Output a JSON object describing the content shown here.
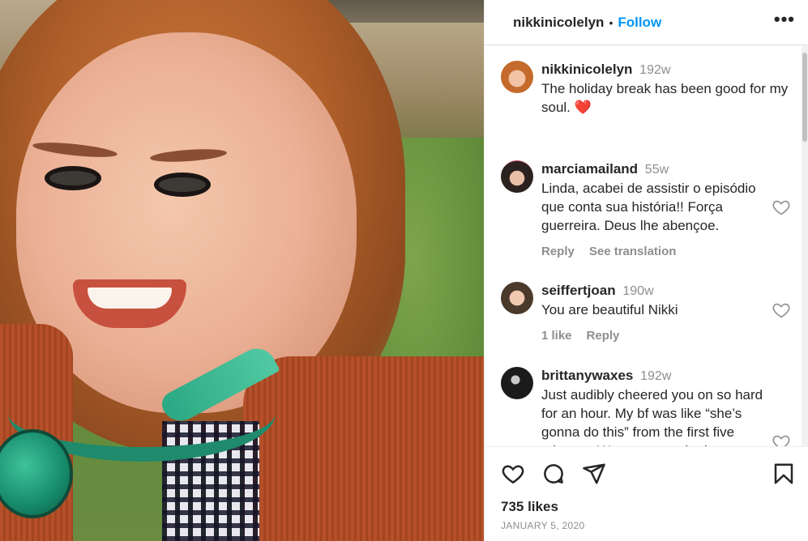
{
  "post": {
    "username": "nikkinicolelyn",
    "separator": "•",
    "follow_label": "Follow",
    "more_icon": "more-horizontal-icon"
  },
  "caption": {
    "username": "nikkinicolelyn",
    "time": "192w",
    "text": "The holiday break has been good for my soul. ❤️"
  },
  "comments": [
    {
      "username": "marciamailand",
      "time": "55w",
      "text": "Linda, acabei de assistir o episódio que conta sua história!! Força guerreira. Deus lhe abençoe.",
      "actions": [
        "Reply",
        "See translation"
      ]
    },
    {
      "username": "seiffertjoan",
      "time": "190w",
      "text": "You are beautiful Nikki",
      "actions": [
        "1 like",
        "Reply"
      ]
    },
    {
      "username": "brittanywaxes",
      "time": "192w",
      "text": "Just audibly cheered you on so hard for an hour. My bf was like “she’s gonna do this” from the first five minutes. We are so excited to"
    }
  ],
  "footer": {
    "likes": "735 likes",
    "date": "JANUARY 5, 2020",
    "icons": [
      "heart-icon",
      "comment-icon",
      "share-icon",
      "bookmark-icon"
    ]
  },
  "colors": {
    "accent": "#0095f6",
    "text": "#262626",
    "muted": "#8e8e8e",
    "border": "#dbdbdb"
  }
}
